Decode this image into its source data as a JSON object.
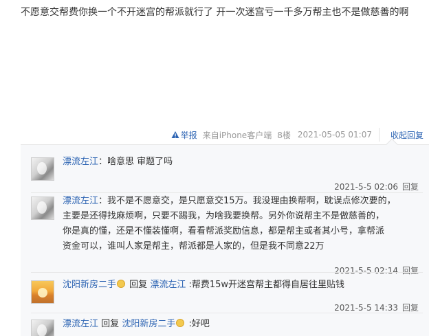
{
  "post": {
    "text": "不愿意交帮费你换一个不开迷宫的帮派就行了 开一次迷宫亏一千多万帮主也不是做慈善的啊"
  },
  "tail": {
    "report_label": "举报",
    "device": "来自iPhone客户端",
    "floor": "8楼",
    "time": "2021-05-05 01:07",
    "collapse_label": "收起回复"
  },
  "replies": [
    {
      "user": "漂流左江",
      "sep": "：",
      "text": "啥意思 审题了吗",
      "time": "2021-5-5 02:06",
      "reply_label": "回复"
    },
    {
      "user": "漂流左江",
      "sep": "：",
      "lines": [
        "我不是不愿意交，是只愿意交15万。我没理由换帮啊，耽误点修次要的，",
        "主要是还得找麻烦啊，只要不踢我，为啥我要换帮。另外你说帮主不是做慈善的，",
        "你是真的懂，还是不懂装懂啊，看看帮派奖励信息，都是帮主或者其小号，拿帮派",
        "资金可以，谁叫人家是帮主，帮派都是人家的，但是我不同意22万"
      ],
      "time": "2021-5-5 02:14",
      "reply_label": "回复"
    },
    {
      "user": "沈阳新房二手",
      "reply_word": "回复",
      "target": "漂流左江",
      "text": ":帮费15w开迷宫帮主都得自居往里贴钱",
      "time": "2021-5-5 14:33",
      "reply_label": "回复"
    },
    {
      "user": "漂流左江",
      "reply_word": "回复",
      "target": "沈阳新房二手",
      "text": ":好吧"
    }
  ],
  "icons": {
    "report": "warning-triangle-icon",
    "emoji": "smiley-emoji-icon"
  },
  "colors": {
    "link": "#2d64b3",
    "meta": "#999999",
    "reply_bg": "#f7f8fa"
  }
}
